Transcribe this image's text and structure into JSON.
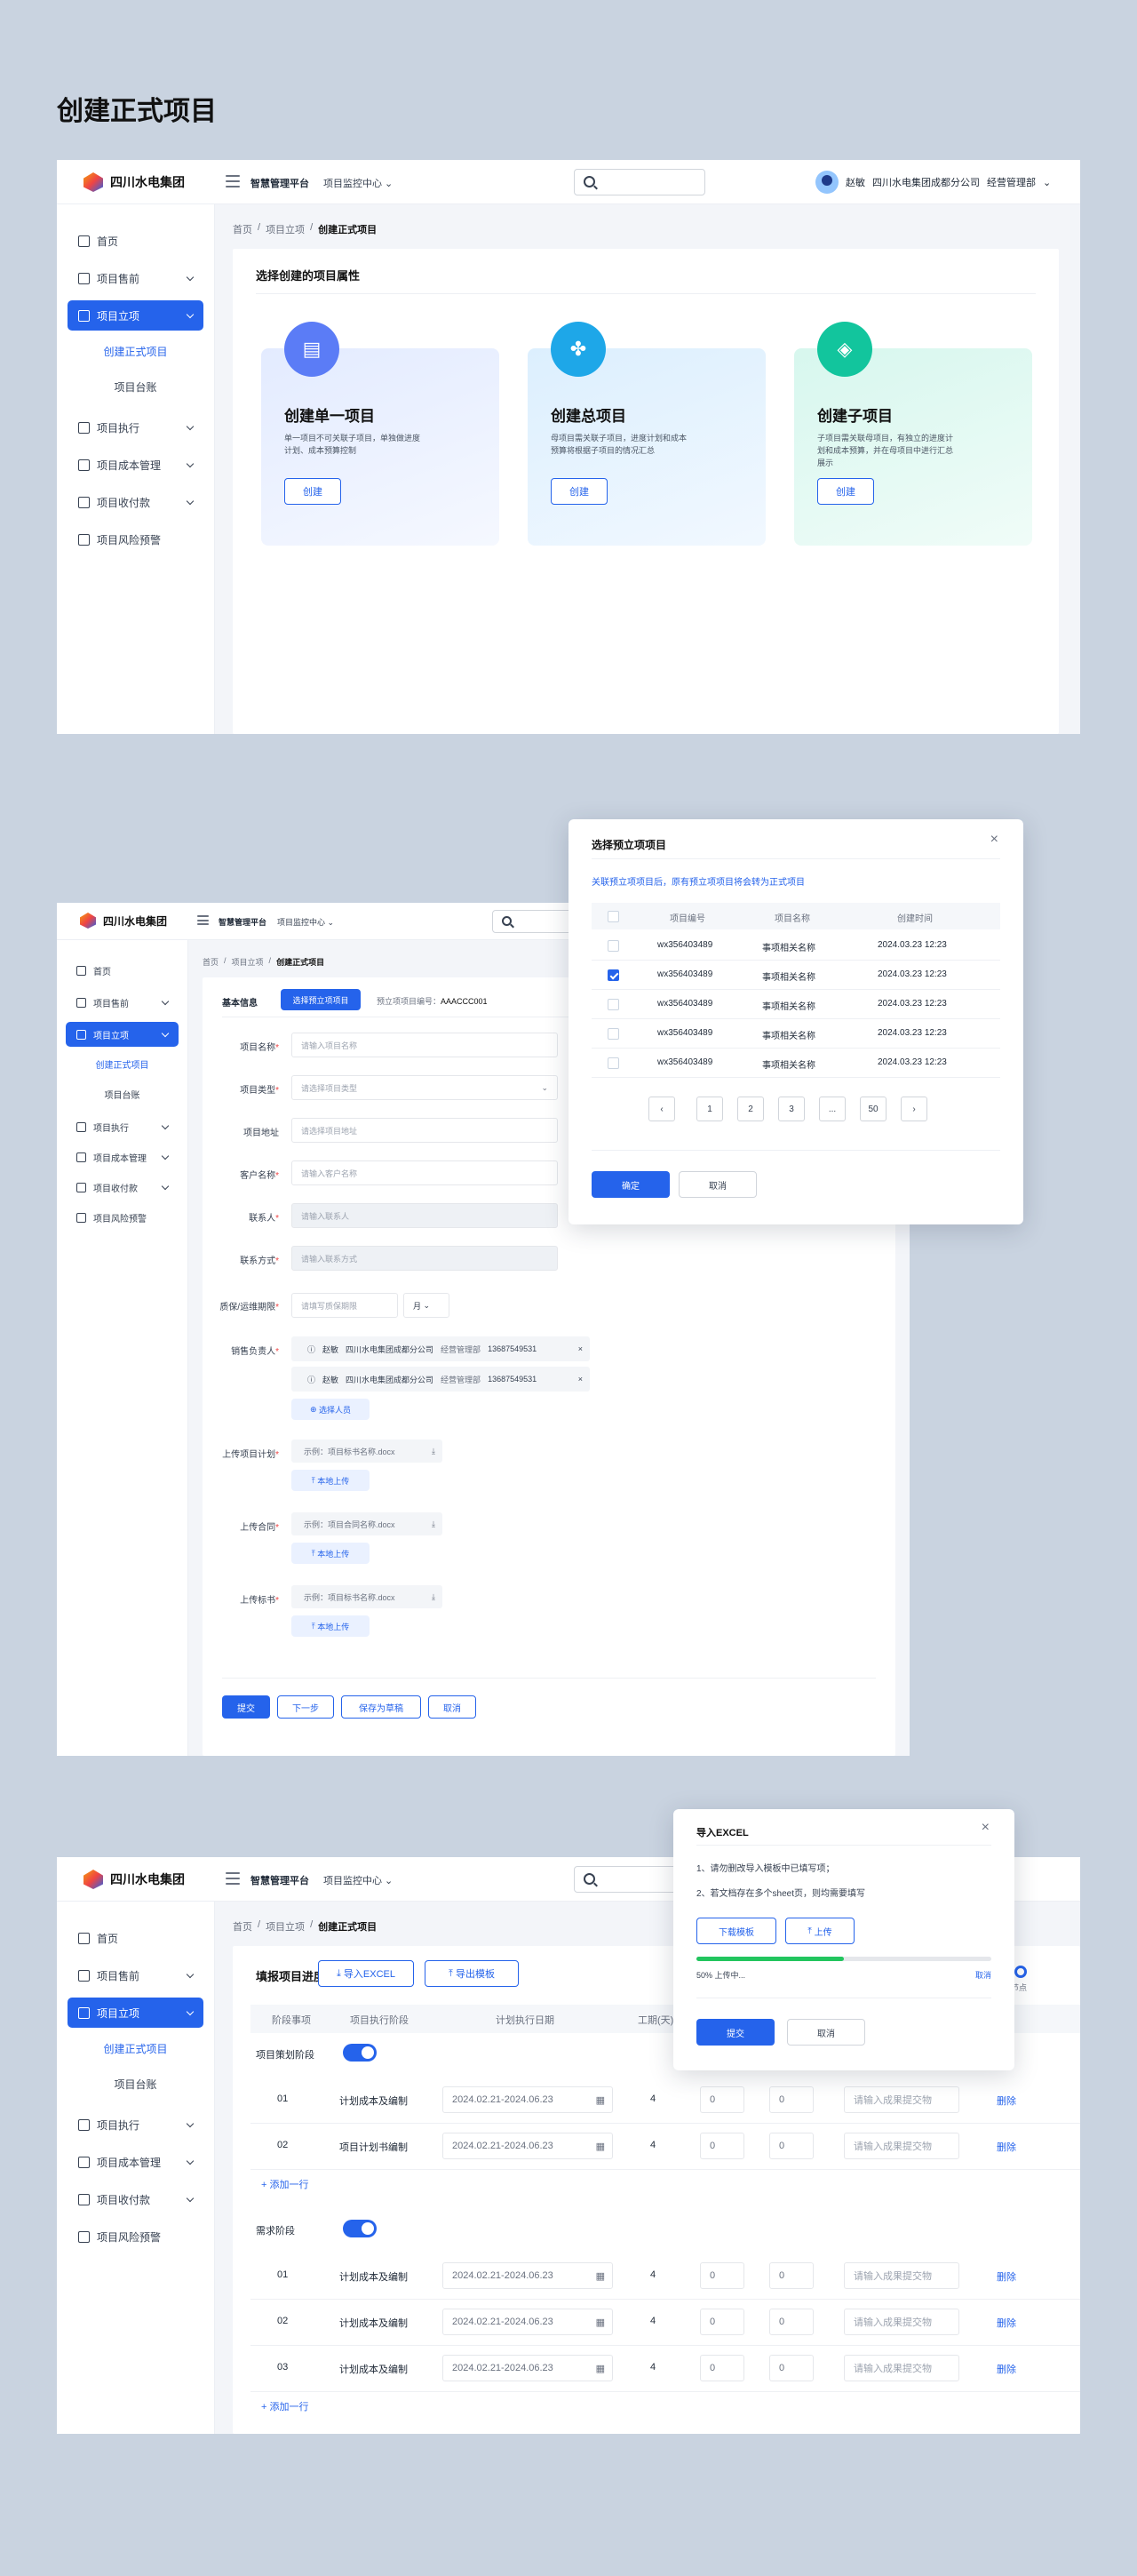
{
  "page_title": "创建正式项目",
  "brand": {
    "name": "四川水电集团",
    "accent": "#2563eb"
  },
  "topbar": {
    "platform": "智慧管理平台",
    "center": "项目监控中心",
    "user_name": "赵敏",
    "company": "四川水电集团成都分公司",
    "dept": "经营管理部"
  },
  "sidebar": {
    "home": "首页",
    "pre": "项目售前",
    "setup": "项目立项",
    "setup_sub": [
      "创建正式项目",
      "项目台账"
    ],
    "exec": "项目执行",
    "cost": "项目成本管理",
    "pay": "项目收付款",
    "risk": "项目风险预警"
  },
  "crumbs": [
    "首页",
    "/",
    "项目立项",
    "/",
    "创建正式项目"
  ],
  "screen1": {
    "section_title": "选择创建的项目属性",
    "cards": [
      {
        "title": "创建单一项目",
        "desc": "单一项目不可关联子项目，单独做进度计划、成本预算控制",
        "btn": "创建",
        "icon": "folder-icon"
      },
      {
        "title": "创建总项目",
        "desc": "母项目需关联子项目，进度计划和成本预算将根据子项目的情况汇总",
        "btn": "创建",
        "icon": "grid-icon"
      },
      {
        "title": "创建子项目",
        "desc": "子项目需关联母项目，有独立的进度计划和成本预算，并在母项目中进行汇总展示",
        "btn": "创建",
        "icon": "layers-icon"
      }
    ]
  },
  "screen2": {
    "tab_basic": "基本信息",
    "tab_select": "选择预立项项目",
    "pre_no_label": "预立项项目编号：",
    "pre_no": "AAACCC001",
    "fields": [
      {
        "label": "项目名称",
        "req": "*",
        "ph": "请输入项目名称"
      },
      {
        "label": "项目类型",
        "req": "*",
        "ph": "请选择项目类型"
      },
      {
        "label": "项目地址",
        "req": "",
        "ph": "请选择项目地址"
      },
      {
        "label": "客户名称",
        "req": "*",
        "ph": "请输入客户名称"
      },
      {
        "label": "联系人",
        "req": "*",
        "ph": "请输入联系人"
      },
      {
        "label": "联系方式",
        "req": "*",
        "ph": "请输入联系方式"
      }
    ],
    "warranty_label": "质保/运维期限",
    "warranty_req": "*",
    "warranty_ph": "请填写质保期限",
    "warranty_unit": "月",
    "sales_label": "销售负责人",
    "sales_req": "*",
    "sales": [
      {
        "name": "赵敏",
        "company": "四川水电集团成都分公司",
        "dept": "经营管理部",
        "phone": "13687549531"
      },
      {
        "name": "赵敏",
        "company": "四川水电集团成都分公司",
        "dept": "经营管理部",
        "phone": "13687549531"
      }
    ],
    "choose_person": "选择人员",
    "uploads": [
      {
        "label": "上传项目计划",
        "req": "*",
        "file": "示例：项目标书名称.docx",
        "btn": "本地上传"
      },
      {
        "label": "上传合同",
        "req": "*",
        "file": "示例：项目合同名称.docx",
        "btn": "本地上传"
      },
      {
        "label": "上传标书",
        "req": "*",
        "file": "示例：项目标书名称.docx",
        "btn": "本地上传"
      }
    ],
    "actions": [
      "提交",
      "下一步",
      "保存为草稿",
      "取消"
    ]
  },
  "modal1": {
    "title": "选择预立项项目",
    "hint": "关联预立项项目后，原有预立项项目将会转为正式项目",
    "headers": [
      "项目编号",
      "项目名称",
      "创建时间"
    ],
    "rows": [
      {
        "no": "wx356403489",
        "name": "事项相关名称",
        "time": "2024.03.23 12:23",
        "checked": false
      },
      {
        "no": "wx356403489",
        "name": "事项相关名称",
        "time": "2024.03.23 12:23",
        "checked": true
      },
      {
        "no": "wx356403489",
        "name": "事项相关名称",
        "time": "2024.03.23 12:23",
        "checked": false
      },
      {
        "no": "wx356403489",
        "name": "事项相关名称",
        "time": "2024.03.23 12:23",
        "checked": false
      },
      {
        "no": "wx356403489",
        "name": "事项相关名称",
        "time": "2024.03.23 12:23",
        "checked": false
      }
    ],
    "pages": [
      "1",
      "2",
      "3",
      "...",
      "50"
    ],
    "ok": "确定",
    "cancel": "取消"
  },
  "screen3": {
    "title": "填报项目进度计划",
    "import_btn": "导入EXCEL",
    "export_btn": "导出模板",
    "headers": [
      "阶段事项",
      "项目执行阶段",
      "计划执行日期",
      "工期(天)"
    ],
    "node_label": "节点",
    "stages": [
      {
        "name": "项目策划阶段",
        "rows": [
          {
            "no": "01",
            "phase": "计划成本及编制",
            "date": "2024.02.21-2024.06.23",
            "days": "4",
            "a": "0",
            "b": "0",
            "ph": "请输入成果提交物",
            "del": "删除"
          },
          {
            "no": "02",
            "phase": "项目计划书编制",
            "date": "2024.02.21-2024.06.23",
            "days": "4",
            "a": "0",
            "b": "0",
            "ph": "请输入成果提交物",
            "del": "删除"
          }
        ]
      },
      {
        "name": "需求阶段",
        "rows": [
          {
            "no": "01",
            "phase": "计划成本及编制",
            "date": "2024.02.21-2024.06.23",
            "days": "4",
            "a": "0",
            "b": "0",
            "ph": "请输入成果提交物",
            "del": "删除"
          },
          {
            "no": "02",
            "phase": "计划成本及编制",
            "date": "2024.02.21-2024.06.23",
            "days": "4",
            "a": "0",
            "b": "0",
            "ph": "请输入成果提交物",
            "del": "删除"
          },
          {
            "no": "03",
            "phase": "计划成本及编制",
            "date": "2024.02.21-2024.06.23",
            "days": "4",
            "a": "0",
            "b": "0",
            "ph": "请输入成果提交物",
            "del": "删除"
          }
        ]
      }
    ],
    "add_row": "+ 添加一行"
  },
  "modal2": {
    "title": "导入EXCEL",
    "tips": [
      "1、请勿删改导入模板中已填写项；",
      "2、若文档存在多个sheet页，则均需要填写"
    ],
    "download": "下载模板",
    "upload": "上传",
    "progress": 0.5,
    "progress_text": "50% 上传中...",
    "cancel_link": "取消",
    "submit": "提交",
    "cancel": "取消"
  }
}
